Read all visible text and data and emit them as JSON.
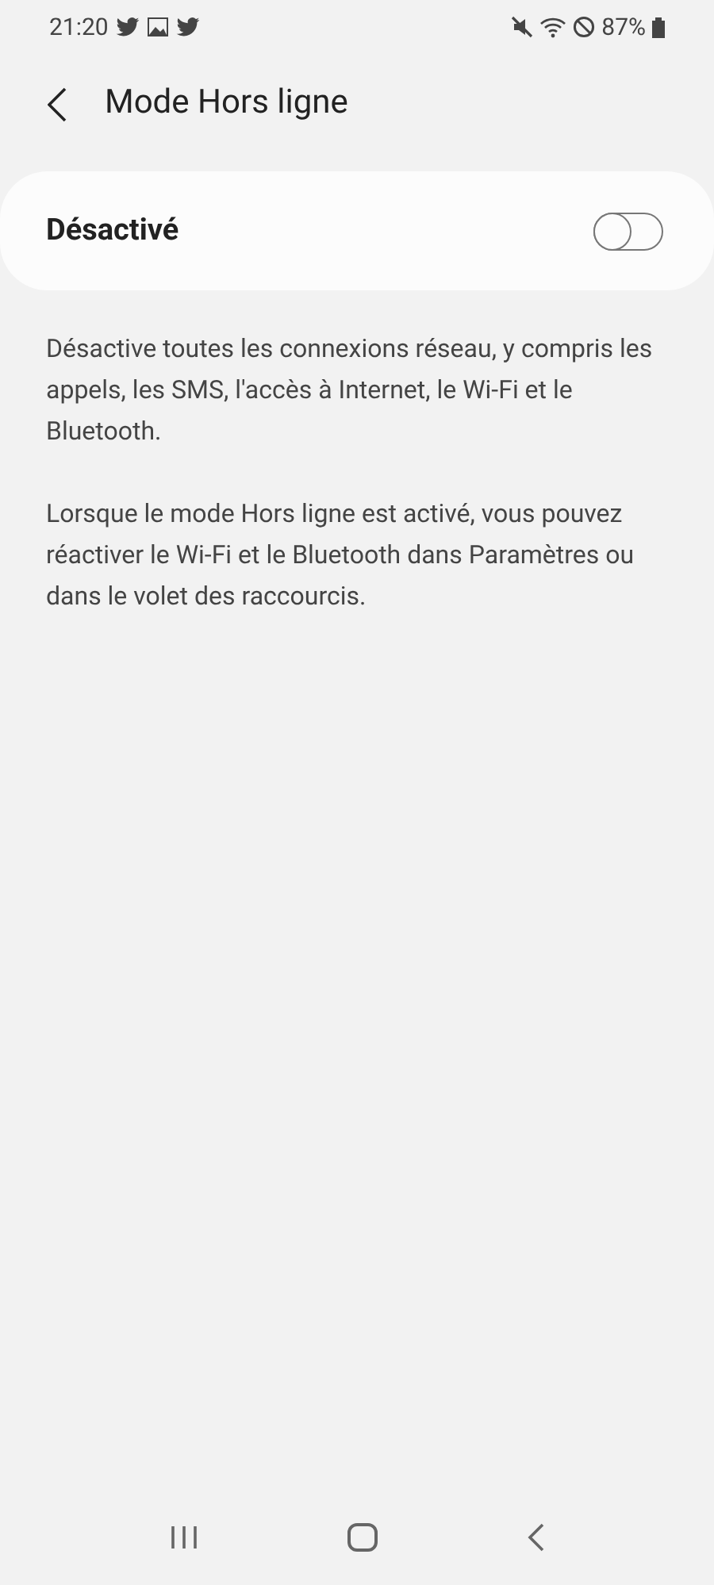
{
  "status_bar": {
    "time": "21:20",
    "battery": "87%"
  },
  "header": {
    "title": "Mode Hors ligne"
  },
  "setting": {
    "label": "Désactivé",
    "on": false
  },
  "descriptions": [
    "Désactive toutes les connexions réseau, y compris les appels, les SMS, l'accès à Internet, le Wi-Fi et le Bluetooth.",
    "Lorsque le mode Hors ligne est activé, vous pouvez réactiver le Wi-Fi et le Bluetooth dans Paramètres ou dans le volet des raccourcis."
  ]
}
